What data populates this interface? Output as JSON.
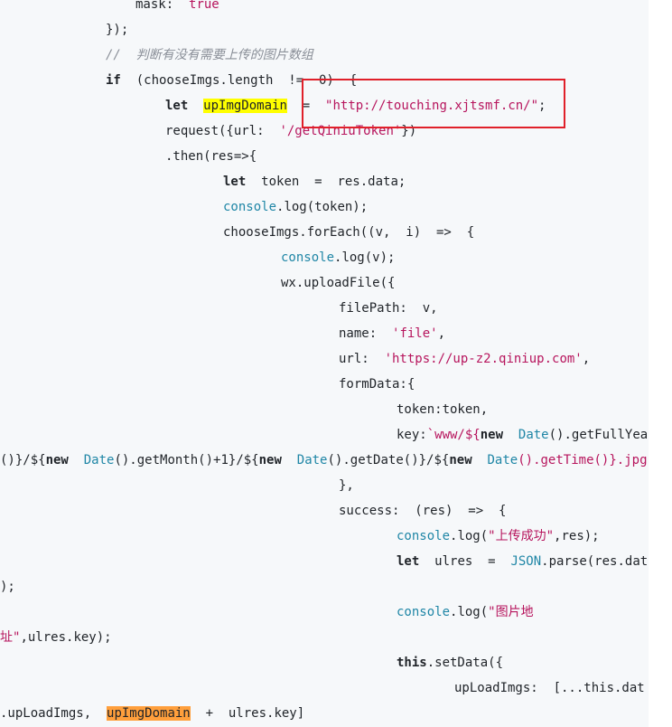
{
  "colors": {
    "background": "#f6f8fa",
    "keyword": "#1f2328",
    "string": "#b7155d",
    "comment": "#8a8f98",
    "builtin": "#1f86a6",
    "highlight_yellow": "#ffff00",
    "highlight_orange": "#ff9f3c",
    "annotation_box": "#e0202a"
  },
  "code": {
    "l1": {
      "t1": "mask:  ",
      "t2": "true"
    },
    "l2": {
      "t1": "});"
    },
    "l3": {
      "t1": "//  判断有没有需要上传的图片数组"
    },
    "l4": {
      "t1": "if",
      "t2": "  (chooseImgs.length  !=  0)  {"
    },
    "l5": {
      "t1": "let",
      "t2": "  ",
      "t3": "upImgDomain",
      "t4": "  =  ",
      "t5": "\"http://touching.xjtsmf.cn/\"",
      "t6": ";"
    },
    "l6": {
      "t1": "request({url:  ",
      "t2": "'/getQiniuToken'",
      "t3": "})"
    },
    "l7": {
      "t1": ".then(res=>{"
    },
    "l8": {
      "t1": "let",
      "t2": "  token  =  res.data;"
    },
    "l9": {
      "t1": "console",
      "t2": ".log(token);"
    },
    "l10": {
      "t1": "chooseImgs.forEach((v,  i)  =>  {"
    },
    "l11": {
      "t1": "console",
      "t2": ".log(v);"
    },
    "l12": {
      "t1": "wx.uploadFile({"
    },
    "l13": {
      "t1": "filePath:  v,"
    },
    "l14": {
      "t1": "name:  ",
      "t2": "'file'",
      "t3": ","
    },
    "l15": {
      "t1": "url:  ",
      "t2": "'https://up-z2.qiniup.com'",
      "t3": ","
    },
    "l16": {
      "t1": "formData:{"
    },
    "l17": {
      "t1": "token:token,"
    },
    "l18": {
      "t1": "key:",
      "t2": "`www/${",
      "t3": "new",
      "t4": "  ",
      "t5": "Date",
      "t6": "().getFullYea"
    },
    "l19": {
      "t1": "()}/${",
      "t2": "new",
      "t3": "  ",
      "t4": "Date",
      "t5": "().getMonth()+1}/${",
      "t6": "new",
      "t7": "  ",
      "t8": "Date",
      "t9": "().getDate()}/${",
      "t10": "new",
      "t11": "  ",
      "t12": "Date",
      "t13": "().getTime()}.jpg`"
    },
    "l20": {
      "t1": "},"
    },
    "l21": {
      "t1": "success:  (res)  =>  {"
    },
    "l22": {
      "t1": "console",
      "t2": ".log(",
      "t3": "\"上传成功\"",
      "t4": ",res);"
    },
    "l23": {
      "t1": "let",
      "t2": "  ulres  =  ",
      "t3": "JSON",
      "t4": ".parse(res.dat"
    },
    "l24": {
      "t1": ");"
    },
    "l25": {
      "t1": "console",
      "t2": ".log(",
      "t3": "\"图片地"
    },
    "l26": {
      "t1": "址\"",
      "t2": ",ulres.key);"
    },
    "l27": {
      "t1": "this",
      "t2": ".setData({"
    },
    "l28": {
      "t1": "upLoadImgs:  [...this.dat"
    },
    "l29": {
      "t1": ".upLoadImgs,  ",
      "t2": "upImgDomain",
      "t3": "  +  ulres.key]"
    }
  }
}
